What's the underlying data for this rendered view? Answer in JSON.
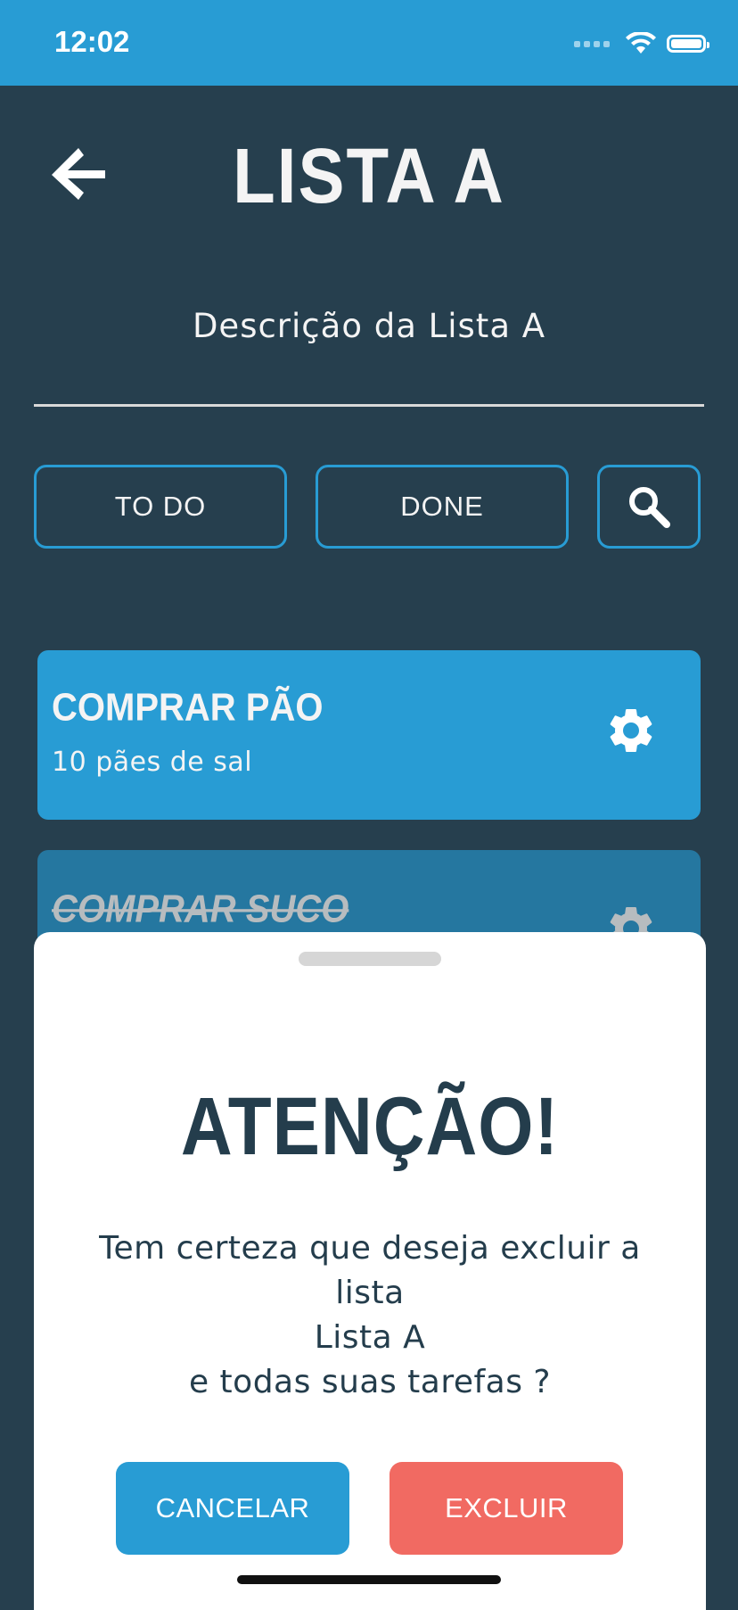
{
  "status_bar": {
    "time": "12:02",
    "wifi_icon": "wifi-icon",
    "battery_icon": "battery-icon"
  },
  "header": {
    "back_icon": "arrow-left-icon",
    "title": "LISTA A",
    "description": "Descrição da Lista A"
  },
  "filters": {
    "todo_label": "TO DO",
    "done_label": "DONE",
    "search_icon": "search-icon"
  },
  "tasks": [
    {
      "title": "COMPRAR PÃO",
      "subtitle": "10 pães de sal",
      "done": false
    },
    {
      "title": "COMPRAR SUCO",
      "subtitle": "",
      "done": true
    }
  ],
  "dialog": {
    "title": "ATENÇÃO!",
    "message_lines": [
      "Tem certeza que deseja excluir a",
      "lista",
      "Lista A",
      "e todas suas tarefas ?"
    ],
    "cancel_label": "CANCELAR",
    "delete_label": "EXCLUIR"
  },
  "colors": {
    "background": "#263f4e",
    "accent": "#289cd4",
    "task_done": "#2577a0",
    "danger": "#f16a62",
    "dialog_text": "#243d4c"
  }
}
